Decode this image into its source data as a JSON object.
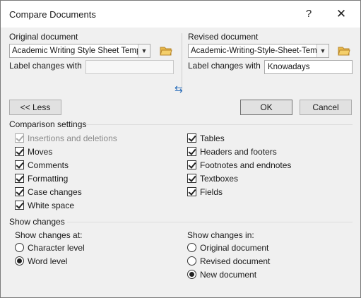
{
  "window": {
    "title": "Compare Documents",
    "help": "?",
    "close": "✕"
  },
  "original": {
    "heading": "Original document",
    "value": "Academic Writing Style Sheet Temp",
    "label_changes": "Label changes with",
    "label_value": ""
  },
  "revised": {
    "heading": "Revised document",
    "value": "Academic-Writing-Style-Sheet-Tem",
    "label_changes": "Label changes with",
    "label_value": "Knowadays"
  },
  "swap_icon": "swap-documents-icon",
  "buttons": {
    "less": "<< Less",
    "ok": "OK",
    "cancel": "Cancel"
  },
  "comparison": {
    "heading": "Comparison settings",
    "left": [
      {
        "label": "Insertions and deletions",
        "checked": true,
        "enabled": false
      },
      {
        "label": "Moves",
        "checked": true,
        "enabled": true
      },
      {
        "label": "Comments",
        "checked": true,
        "enabled": true
      },
      {
        "label": "Formatting",
        "checked": true,
        "enabled": true
      },
      {
        "label": "Case changes",
        "checked": true,
        "enabled": true
      },
      {
        "label": "White space",
        "checked": true,
        "enabled": true
      }
    ],
    "right": [
      {
        "label": "Tables",
        "checked": true
      },
      {
        "label": "Headers and footers",
        "checked": true
      },
      {
        "label": "Footnotes and endnotes",
        "checked": true
      },
      {
        "label": "Textboxes",
        "checked": true
      },
      {
        "label": "Fields",
        "checked": true
      }
    ]
  },
  "show_changes": {
    "heading": "Show changes",
    "at": {
      "label": "Show changes at:",
      "options": [
        {
          "label": "Character level",
          "selected": false
        },
        {
          "label": "Word level",
          "selected": true
        }
      ]
    },
    "in": {
      "label": "Show changes in:",
      "options": [
        {
          "label": "Original document",
          "selected": false
        },
        {
          "label": "Revised document",
          "selected": false
        },
        {
          "label": "New document",
          "selected": true
        }
      ]
    }
  },
  "colors": {
    "folder": "#e8b84a",
    "swap": "#2a6ebb"
  }
}
